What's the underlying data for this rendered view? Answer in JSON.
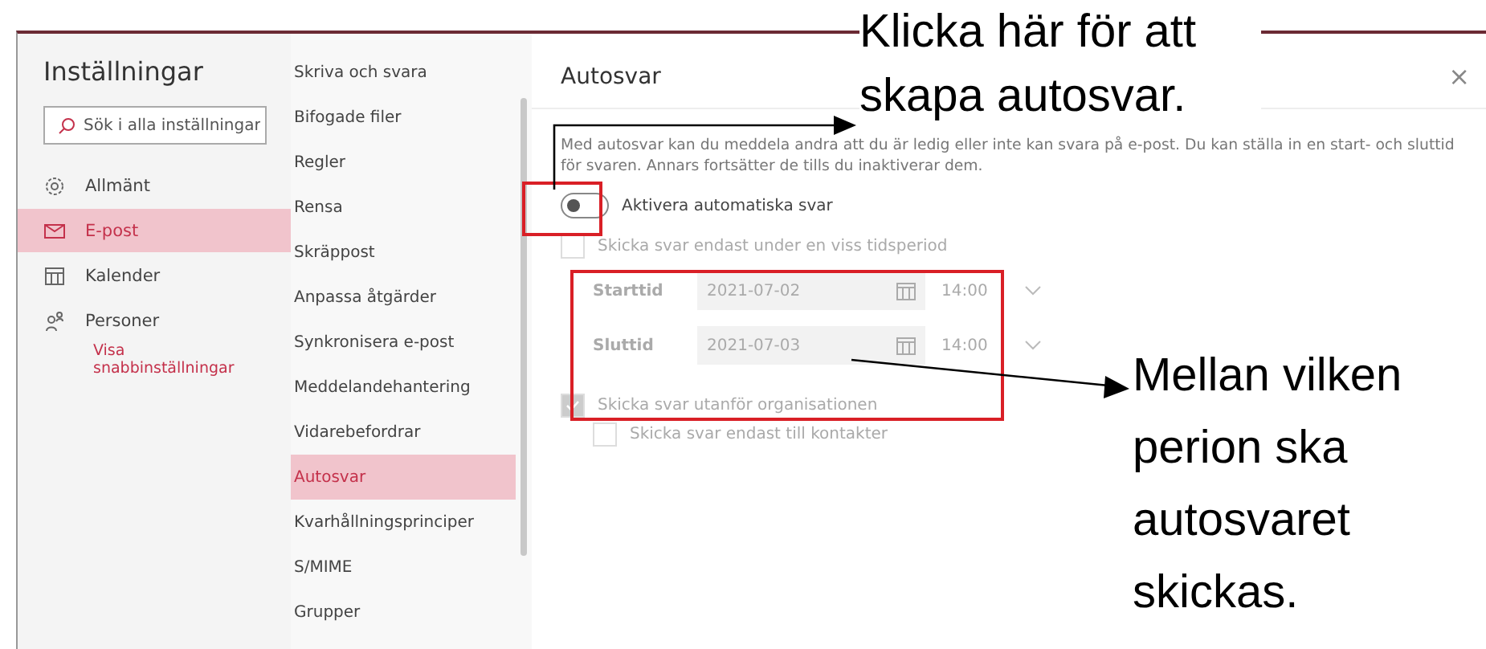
{
  "settings": {
    "title": "Inställningar",
    "search": {
      "placeholder": "Sök i alla inställningar"
    },
    "nav": [
      {
        "label": "Allmänt",
        "selected": false
      },
      {
        "label": "E-post",
        "selected": true
      },
      {
        "label": "Kalender",
        "selected": false
      },
      {
        "label": "Personer",
        "selected": false
      }
    ],
    "quick_link": "Visa snabbinställningar"
  },
  "submenu": [
    {
      "label": "Skriva och svara",
      "selected": false
    },
    {
      "label": "Bifogade filer",
      "selected": false
    },
    {
      "label": "Regler",
      "selected": false
    },
    {
      "label": "Rensa",
      "selected": false
    },
    {
      "label": "Skräppost",
      "selected": false
    },
    {
      "label": "Anpassa åtgärder",
      "selected": false
    },
    {
      "label": "Synkronisera e-post",
      "selected": false
    },
    {
      "label": "Meddelandehantering",
      "selected": false
    },
    {
      "label": "Vidarebefordrar",
      "selected": false
    },
    {
      "label": "Autosvar",
      "selected": true
    },
    {
      "label": "Kvarhållningsprinciper",
      "selected": false
    },
    {
      "label": "S/MIME",
      "selected": false
    },
    {
      "label": "Grupper",
      "selected": false
    }
  ],
  "panel": {
    "title": "Autosvar",
    "close": "×",
    "description": "Med autosvar kan du meddela andra att du är ledig eller inte kan svara på e-post. Du kan ställa in en start- och sluttid för svaren. Annars fortsätter de tills du inaktiverar dem.",
    "toggle": {
      "label": "Aktivera automatiska svar",
      "on": false
    },
    "period_checkbox": {
      "label": "Skicka svar endast under en viss tidsperiod",
      "checked": false,
      "disabled": true
    },
    "times": [
      {
        "label": "Starttid",
        "date": "2021-07-02",
        "time": "14:00"
      },
      {
        "label": "Sluttid",
        "date": "2021-07-03",
        "time": "14:00"
      }
    ],
    "outside_checkbox": {
      "label": "Skicka svar utanför organisationen",
      "checked": true,
      "disabled": true
    },
    "contacts_checkbox": {
      "label": "Skicka svar endast till kontakter",
      "checked": false,
      "disabled": true
    }
  },
  "annotations": [
    {
      "text": "Klicka här för att skapa autosvar."
    },
    {
      "text": "Mellan vilken perion ska autosvaret skickas."
    }
  ]
}
